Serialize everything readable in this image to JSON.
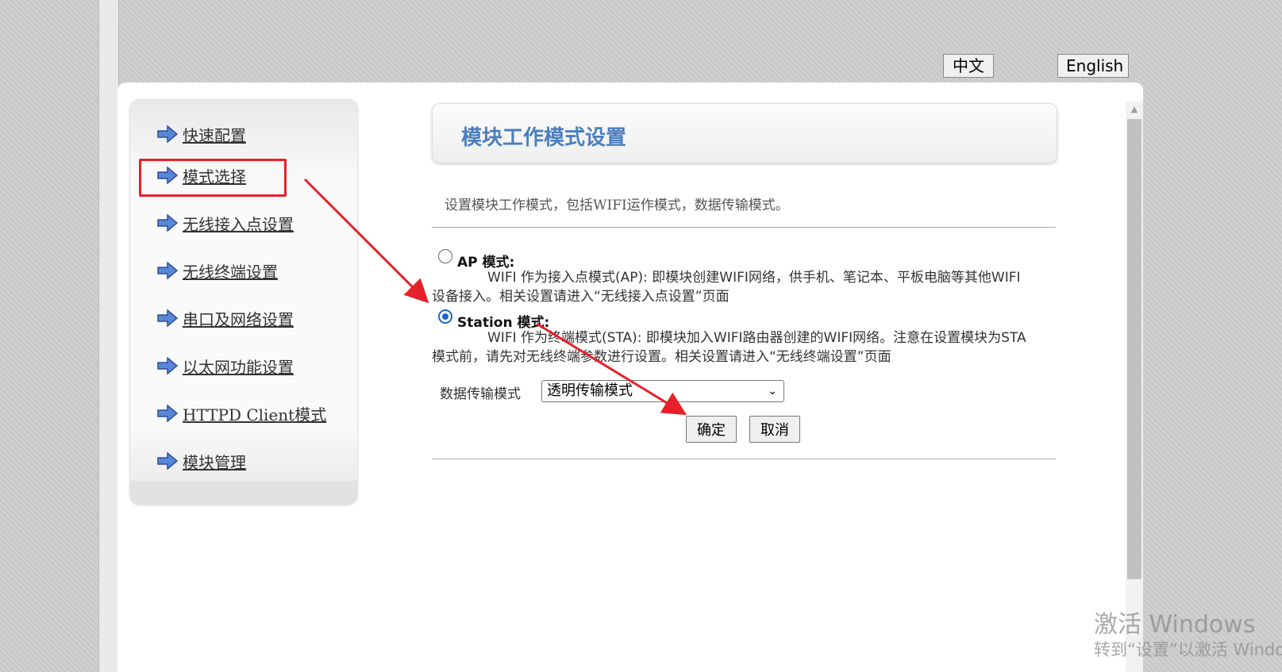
{
  "lang": {
    "chinese": "中文",
    "english": "English"
  },
  "sidebar": {
    "items": [
      {
        "label": "快速配置",
        "icon": "arrow-right-icon"
      },
      {
        "label": "模式选择",
        "icon": "arrow-right-icon"
      },
      {
        "label": "无线接入点设置",
        "icon": "arrow-right-icon"
      },
      {
        "label": "无线终端设置",
        "icon": "arrow-right-icon"
      },
      {
        "label": "串口及网络设置",
        "icon": "arrow-right-icon"
      },
      {
        "label": "以太网功能设置",
        "icon": "arrow-right-icon"
      },
      {
        "label": "HTTPD Client模式",
        "icon": "arrow-right-icon"
      },
      {
        "label": "模块管理",
        "icon": "arrow-right-icon"
      }
    ],
    "selected": "模式选择"
  },
  "main": {
    "title": "模块工作模式设置",
    "description": "设置模块工作模式，包括WIFI运作模式，数据传输模式。",
    "ap": {
      "title": "AP 模式:",
      "line1": "WIFI 作为接入点模式(AP): 即模块创建WIFI网络，供手机、笔记本、平板电脑等其他WIFI",
      "line2": "设备接入。相关设置请进入“无线接入点设置”页面",
      "checked": false
    },
    "station": {
      "title": "Station 模式:",
      "line1": "WIFI 作为终端模式(STA): 即模块加入WIFI路由器创建的WIFI网络。注意在设置模块为STA",
      "line2": "模式前，请先对无线终端参数进行设置。相关设置请进入“无线终端设置”页面",
      "checked": true
    },
    "transfer_label": "数据传输模式",
    "transfer_value": "透明传输模式",
    "ok_label": "确定",
    "cancel_label": "取消"
  },
  "watermark": {
    "line1": "激活 Windows",
    "line2": "转到“设置”以激活 Windo"
  },
  "colors": {
    "title_blue": "#4a7fbf",
    "annotation_red": "#e8202a",
    "radio_blue": "#1a66cc"
  }
}
